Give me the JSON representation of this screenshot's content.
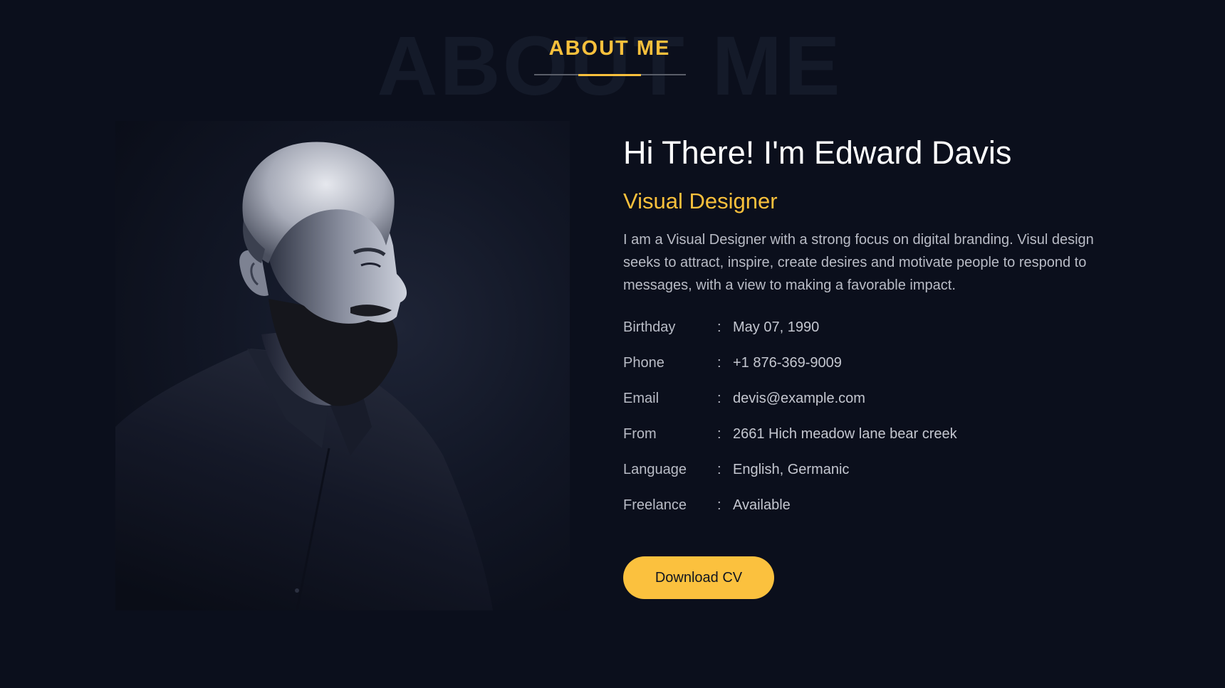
{
  "section": {
    "title": "ABOUT ME",
    "background_title": "ABOUT ME",
    "accent_color": "#f9c03c",
    "background_color": "#0b0f1c"
  },
  "profile": {
    "greeting": "Hi There! I'm Edward Davis",
    "role": "Visual Designer",
    "bio": "I am a Visual Designer with a strong focus on digital branding. Visul design seeks to attract, inspire, create desires and motivate people to respond to messages, with a view to making a favorable impact.",
    "separator": ":",
    "details": [
      {
        "label": "Birthday",
        "value": "May 07, 1990"
      },
      {
        "label": "Phone",
        "value": "+1 876-369-9009"
      },
      {
        "label": "Email",
        "value": "devis@example.com"
      },
      {
        "label": "From",
        "value": "2661 Hich meadow lane bear creek"
      },
      {
        "label": "Language",
        "value": "English, Germanic"
      },
      {
        "label": "Freelance",
        "value": "Available"
      }
    ],
    "cta_label": "Download CV"
  }
}
